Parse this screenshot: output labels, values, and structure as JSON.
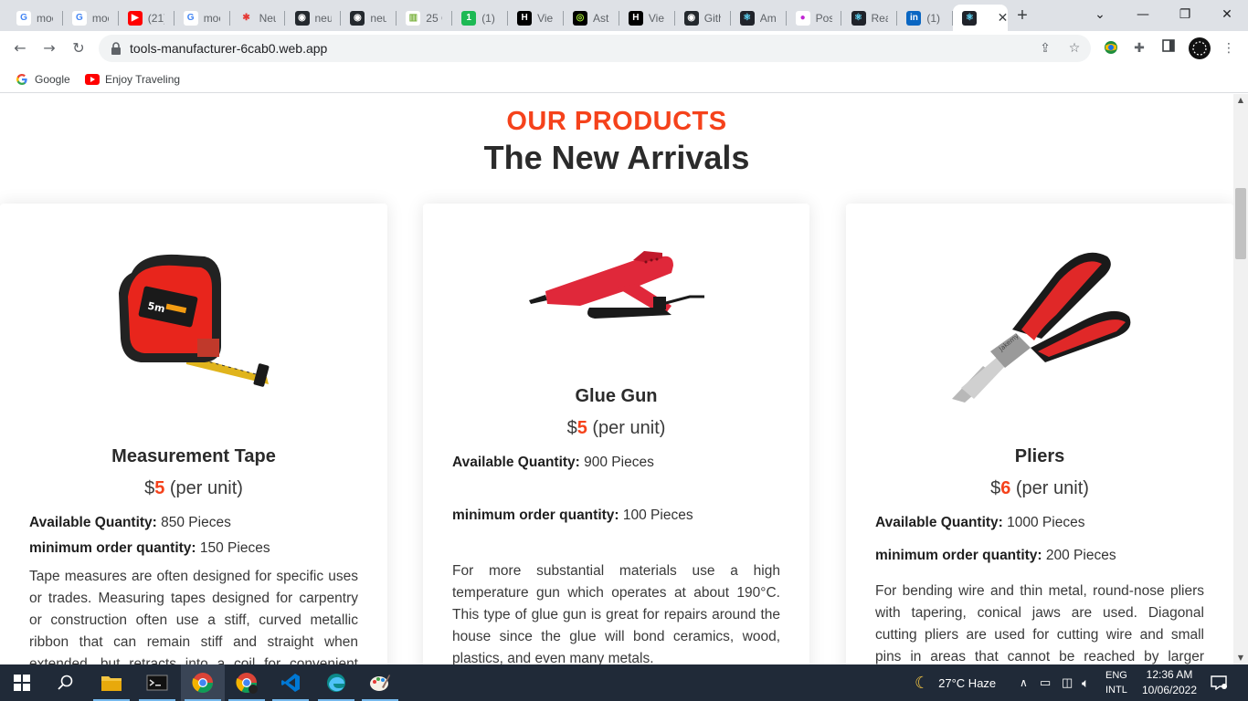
{
  "browser": {
    "tabs": [
      {
        "label": "moc",
        "icon": "google-icon"
      },
      {
        "label": "moc",
        "icon": "google-icon"
      },
      {
        "label": "(21)",
        "icon": "youtube-icon"
      },
      {
        "label": "moc",
        "icon": "google-icon"
      },
      {
        "label": "Neu",
        "icon": "asterisk-icon"
      },
      {
        "label": "neu",
        "icon": "github-icon"
      },
      {
        "label": "neu",
        "icon": "github-icon"
      },
      {
        "label": "25 C",
        "icon": "chart-icon"
      },
      {
        "label": "(1) \\",
        "icon": "number-one-icon"
      },
      {
        "label": "Vie",
        "icon": "h-icon"
      },
      {
        "label": "Astr",
        "icon": "astro-icon"
      },
      {
        "label": "Vie",
        "icon": "h-icon"
      },
      {
        "label": "Gith",
        "icon": "github-icon"
      },
      {
        "label": "Am",
        "icon": "react-icon"
      },
      {
        "label": "Post",
        "icon": "postman-icon"
      },
      {
        "label": "Rea",
        "icon": "react-icon"
      },
      {
        "label": "(1) /",
        "icon": "linkedin-icon"
      },
      {
        "label": "",
        "icon": "react-icon",
        "active": true
      }
    ],
    "url": "tools-manufacturer-6cab0.web.app",
    "bookmarks": [
      {
        "label": "Google",
        "icon": "google-icon"
      },
      {
        "label": "Enjoy Traveling",
        "icon": "youtube-icon"
      }
    ]
  },
  "page": {
    "eyebrow": "OUR PRODUCTS",
    "title": "The New Arrivals",
    "products": [
      {
        "name": "Measurement Tape",
        "currency": "$",
        "price": "5",
        "unit": "(per unit)",
        "available_label": "Available Quantity:",
        "available_value": "850 Pieces",
        "min_label": "minimum order quantity:",
        "min_value": "150 Pieces",
        "description": "Tape measures are often designed for specific uses or trades. Measuring tapes designed for carpentry or construction often use a stiff, curved metallic ribbon that can remain stiff and straight when extended, but retracts into a coil for convenient storage."
      },
      {
        "name": "Glue Gun",
        "currency": "$",
        "price": "5",
        "unit": "(per unit)",
        "available_label": "Available Quantity:",
        "available_value": "900 Pieces",
        "min_label": "minimum order quantity:",
        "min_value": "100 Pieces",
        "description": "For more substantial materials use a high temperature gun which operates at about 190°C. This type of glue gun is great for repairs around the house since the glue will bond ceramics, wood, plastics, and even many metals."
      },
      {
        "name": "Pliers",
        "currency": "$",
        "price": "6",
        "unit": "(per unit)",
        "available_label": "Available Quantity:",
        "available_value": "1000 Pieces",
        "min_label": "minimum order quantity:",
        "min_value": "200 Pieces",
        "description": "For bending wire and thin metal, round-nose pliers with tapering, conical jaws are used. Diagonal cutting pliers are used for cutting wire and small pins in areas that cannot be reached by larger cutting tools."
      }
    ]
  },
  "taskbar": {
    "weather": "27°C  Haze",
    "lang_top": "ENG",
    "lang_bottom": "INTL",
    "time": "12:36 AM",
    "date": "10/06/2022"
  },
  "colors": {
    "accent": "#f5421b",
    "heading": "#2b2b2b",
    "taskbar": "#202a38"
  }
}
